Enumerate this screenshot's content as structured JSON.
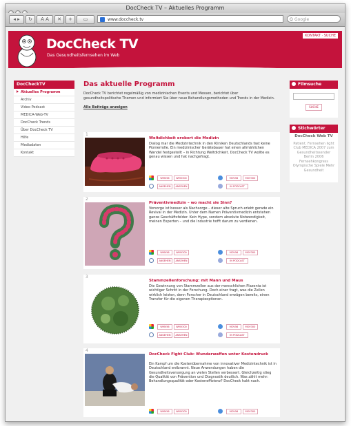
{
  "window": {
    "title": "DocCheck TV – Aktuelles Programm",
    "url": "www.doccheck.tv",
    "search_placeholder": "Google",
    "search_icon": "Q"
  },
  "header": {
    "logo_doccheck": "DocCheck",
    "logo_tv": "TV",
    "tagline": "Das Gesundheitsfernsehen im Web",
    "top_links": "KONTAKT · SUCHE"
  },
  "left_nav": {
    "title": "DocCheckTV",
    "items": [
      {
        "label": "Aktuelles Programm"
      },
      {
        "label": "Archiv"
      },
      {
        "label": "Video Podcast"
      },
      {
        "label": "MEDICA-Web-TV"
      },
      {
        "label": "DocCheck Trends"
      },
      {
        "label": "Über DocCheck TV"
      },
      {
        "label": "Hilfe"
      },
      {
        "label": "Mediadaten"
      },
      {
        "label": "Kontakt"
      }
    ]
  },
  "main": {
    "title": "Das aktuelle Programm",
    "intro": "DocCheck TV berichtet regelmäßig von medizinischen Events und Messen, berichtet über gesundheitspolitische Themen und informiert Sie über neue Behandlungsmethoden und Trends in der Medizin.",
    "all_link": "Alle Beiträge anzeigen"
  },
  "articles": [
    {
      "num": "1",
      "title": "Weltdichkeit erobert die Medizin",
      "text": "Dialog mar die Medizintechnik in den Kliniken Deutschlands fast keine Pionierrolle. Ein medizinischer Gerätebauer hat einen allmählichen Wandel festgestellt – in Richtung Weltdichkeit. DocCheck TV wollte es genau wissen und hat nachgefragt.",
      "buttons": [
        "WMV56",
        "WMV300",
        "MOV56",
        "MOV300",
        "ANSEHEN",
        "ANSEHEN",
        "IN PODCAST"
      ]
    },
    {
      "num": "2",
      "title": "Präventivmedizin – wo macht sie Sinn?",
      "text": "Vorsorge ist besser als Nachsorge – dieser alte Spruch erlebt gerade ein Revival in der Medizin. Unter dem Namen Präventivmedizin entstehen ganze Geschäftsfelder. Kein Hype, sondern absolute Notwendigkeit, meinen Experten – und die Industrie hofft darum zu verdienen.",
      "buttons": [
        "WMV56",
        "WMV300",
        "MOV56",
        "MOV300",
        "ANSEHEN",
        "ANSEHEN",
        "IN PODCAST"
      ]
    },
    {
      "num": "3",
      "title": "Stammzellenforschung: mit Mann und Maus",
      "text": "Die Gewinnung von Stammzellen aus der menschlichen Plazenta ist wichtiger Schritt in der Forschung. Doch einer fragt, was die Zellen wirklich leisten, denn Forscher in Deutschland erwägen bereits, einen Transfer für die eigenen Therapieoptionen.",
      "buttons": [
        "WMV56",
        "WMV300",
        "MOV56",
        "MOV300",
        "ANSEHEN",
        "ANSEHEN",
        "IN PODCAST"
      ]
    },
    {
      "num": "4",
      "title": "DocCheck Fight Club: Wunderwaffen unter Kostendruck",
      "text": "Ein Kampf um die Kostenübernahme von innovativer Medizintechnik ist in Deutschland entbrannt. Neue Anwendungen haben die Gesundheitsversorgung an vielen Stellen verbessert. Gleichzeitig stieg die Qualität von Prävention und Diagnostik deutlich. Was zählt mehr: Behandlungsqualität oder Kosteneffizienz? DocCheck hakt nach.",
      "buttons": [
        "WMV56",
        "WMV300",
        "MOV56",
        "MOV300"
      ]
    }
  ],
  "right": {
    "search_title": "Filmsuche",
    "search_button": "SUCHE",
    "tips_title": "Stichwörter",
    "tips_heading": "DocCheck Web TV",
    "tips_text": "Patient. Fernsehen light Club MEDICA 2007 zum Gesundheitssender Berlin 2006 Fernsehkongress Olympische Spiele Mehr Gesundheit"
  },
  "colors": {
    "brand": "#c4133c",
    "page_bg": "#f0f0f0"
  }
}
